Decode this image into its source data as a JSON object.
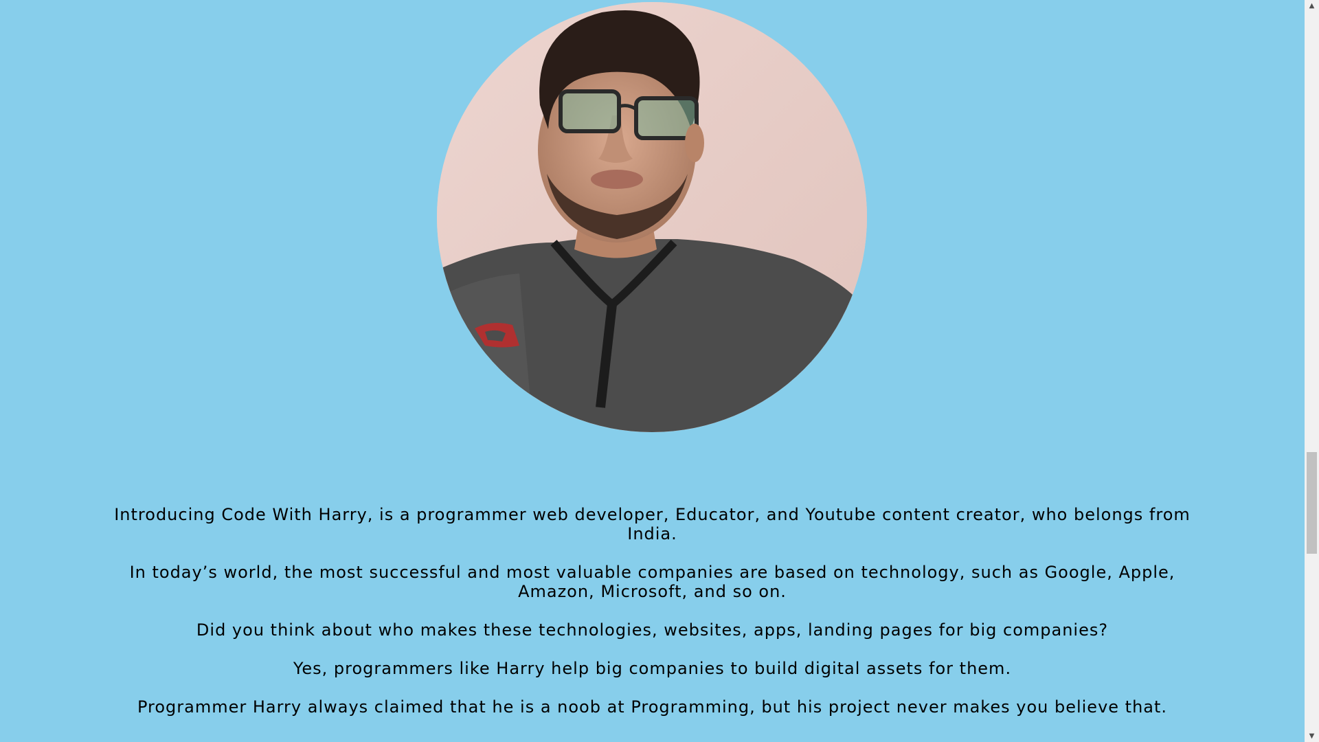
{
  "profile": {
    "photo_icon": "avatar-photo"
  },
  "bio": {
    "paragraphs": [
      "Introducing Code With Harry, is a programmer web developer, Educator, and Youtube content creator, who belongs from India.",
      "In today’s world, the most successful and most valuable companies are based on technology, such as Google, Apple, Amazon, Microsoft, and so on.",
      "Did you think about who makes these technologies, websites, apps, landing pages for big companies?",
      "Yes, programmers like Harry help big companies to build digital assets for them.",
      "Programmer Harry always claimed that he is a noob at Programming, but his project never makes you believe that."
    ]
  },
  "scrollbar": {
    "up_icon": "scroll-up-arrow-icon",
    "down_icon": "scroll-down-arrow-icon"
  },
  "colors": {
    "background": "#87CEEB",
    "text": "#000000"
  }
}
